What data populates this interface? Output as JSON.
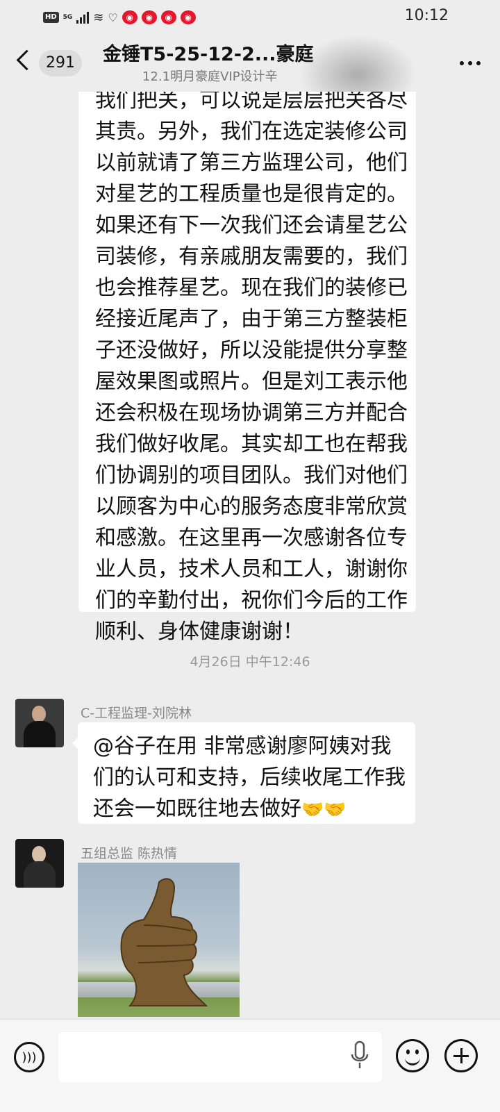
{
  "status_bar": {
    "hd": "HD",
    "network": "5G",
    "time": "10:12"
  },
  "header": {
    "unread_count": "291",
    "title": "金锤T5-25-12-2...豪庭",
    "subtitle": "12.1明月豪庭VIP设计辛",
    "back_icon": "chevron-left-icon",
    "more_icon": "more-dots-icon"
  },
  "messages": {
    "message1_lines": [
      "我们把关，可以说是层层把关各尽",
      "其责。另外，我们在选定装修公司",
      "以前就请了第三方监理公司，他们",
      "对星艺的工程质量也是很肯定的。",
      "如果还有下一次我们还会请星艺公",
      "司装修，有亲戚朋友需要的，我们",
      "也会推荐星艺。现在我们的装修已",
      "经接近尾声了，由于第三方整装柜",
      "子还没做好，所以没能提供分享整",
      "屋效果图或照片。但是刘工表示他",
      "还会积极在现场协调第三方并配合",
      "我们做好收尾。其实却工也在帮我",
      "们协调别的项目团队。我们对他们",
      "以顾客为中心的服务态度非常欣赏",
      "和感激。在这里再一次感谢各位专",
      "业人员，技术人员和工人，谢谢你",
      "们的辛勤付出，祝你们今后的工作",
      "顺利、身体健康谢谢！"
    ],
    "timestamp": "4月26日 中午12:46",
    "message2": {
      "sender": "C-工程监理-刘院林",
      "lines": [
        "@谷子在用  非常感谢廖阿姨对我",
        "们的认可和支持，后续收尾工作我",
        "还会一如既往地去做好"
      ],
      "emoji": "🤝🤝"
    },
    "message3": {
      "sender": "五组总监 陈热情",
      "image_icon": "thumbs-up-statue-image"
    }
  },
  "input_bar": {
    "voice_icon": "voice-icon",
    "mic_icon": "mic-icon",
    "emoji_icon": "emoji-icon",
    "plus_icon": "plus-icon"
  }
}
